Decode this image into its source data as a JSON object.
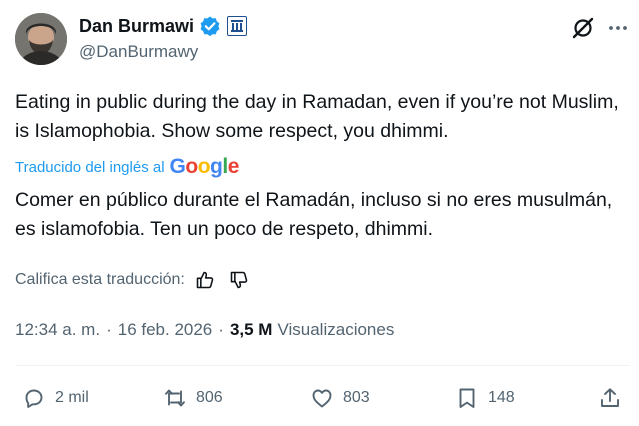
{
  "author": {
    "display_name": "Dan Burmawi",
    "handle": "@DanBurmawy"
  },
  "icons": {
    "verified": "verified-badge-icon",
    "affiliate": "affiliate-badge-icon",
    "grok": "grok-icon",
    "more": "more-options-icon",
    "google": "google-logo",
    "thumbs_up": "thumbs-up-icon",
    "thumbs_down": "thumbs-down-icon",
    "reply": "reply-icon",
    "repost": "repost-icon",
    "like": "heart-icon",
    "bookmark": "bookmark-icon",
    "share": "share-icon"
  },
  "tweet": {
    "text": "Eating in public during the day in Ramadan, even if you’re not Muslim, is Islamophobia. Show some respect, you dhimmi.",
    "translated_label": "Traducido del inglés al",
    "translation": "Comer en público durante el Ramadán, incluso si no eres musulmán, es islamofobia. Ten un poco de respeto, dhimmi.",
    "rate_label": "Califica esta traducción:",
    "time": "12:34 a. m.",
    "date": "16 feb. 2026",
    "separator": "·",
    "views_count": "3,5 M",
    "views_label": "Visualizaciones"
  },
  "google_logo": [
    "G",
    "o",
    "o",
    "g",
    "l",
    "e"
  ],
  "actions": {
    "replies": "2 mil",
    "reposts": "806",
    "likes": "803",
    "bookmarks": "148"
  },
  "colors": {
    "text": "#0f1419",
    "secondary": "#536471",
    "accent": "#1d9bf0",
    "divider": "#eff3f4"
  }
}
